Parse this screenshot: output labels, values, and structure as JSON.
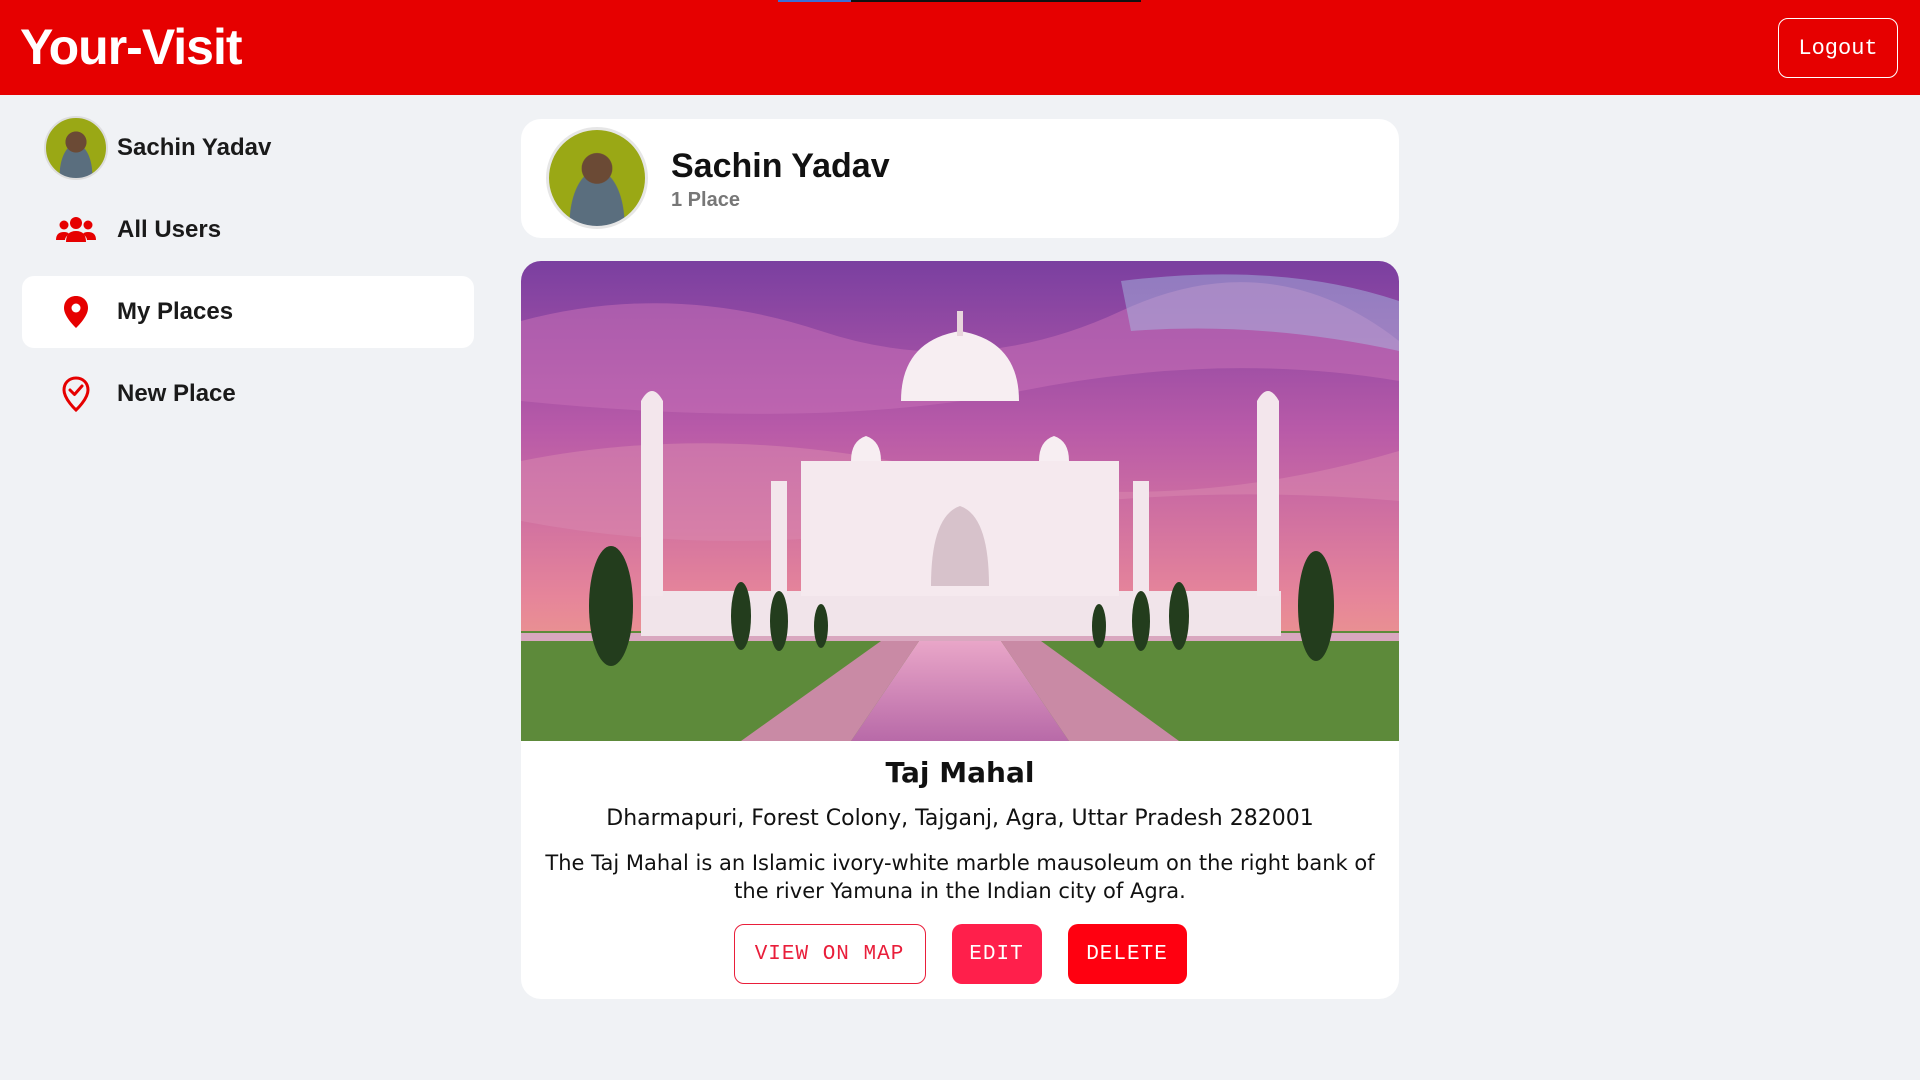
{
  "header": {
    "brand": "Your-Visit",
    "logout_label": "Logout",
    "background": "#e60000"
  },
  "sidebar": {
    "items": [
      {
        "label": "Sachin Yadav",
        "icon": "avatar"
      },
      {
        "label": "All Users",
        "icon": "users-icon"
      },
      {
        "label": "My Places",
        "icon": "map-marker-icon",
        "active": true
      },
      {
        "label": "New Place",
        "icon": "location-check-icon"
      }
    ]
  },
  "profile": {
    "name": "Sachin Yadav",
    "place_count": "1 Place"
  },
  "place": {
    "title": "Taj Mahal",
    "address": "Dharmapuri, Forest Colony, Tajganj, Agra, Uttar Pradesh 282001",
    "description": "The Taj Mahal is an Islamic ivory-white marble mausoleum on the right bank of the river Yamuna in the Indian city of Agra.",
    "actions": {
      "view_on_map": "VIEW ON MAP",
      "edit": "EDIT",
      "delete": "DELETE"
    }
  },
  "colors": {
    "accent": "#e60000",
    "edit_button": "#ff1f4b",
    "delete_button": "#ff0010",
    "page_background": "#f0f2f5"
  }
}
